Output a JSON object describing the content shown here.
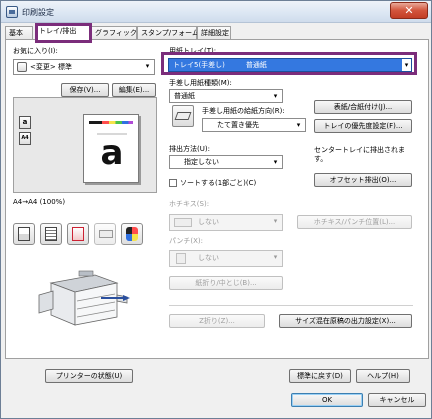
{
  "window": {
    "title": "印刷設定",
    "close_label": "✕"
  },
  "tabs": [
    {
      "label": "基本"
    },
    {
      "label": "トレイ/排出"
    },
    {
      "label": "グラフィックス"
    },
    {
      "label": "スタンプ/フォーム"
    },
    {
      "label": "詳細設定"
    }
  ],
  "favorites": {
    "label": "お気に入り(I):",
    "value": "<変更> 標準",
    "save_label": "保存(V)...",
    "edit_label": "編集(E)..."
  },
  "paper_tray": {
    "label": "用紙トレイ(T):",
    "value": "トレイ5(手差し)　　　普通紙"
  },
  "manual_paper_type": {
    "label": "手差し用紙種類(M):",
    "value": "普通紙"
  },
  "manual_orientation": {
    "label": "手差し用紙の給紙方向(R):",
    "value": "たて置き優先"
  },
  "buttons_right": {
    "cover_insert": "表紙/合紙付け(J)...",
    "tray_priority": "トレイの優先度設定(F)..."
  },
  "output": {
    "label": "排出方法(U):",
    "value": "指定しない",
    "sort_label": "ソートする(1部ごと)(C)",
    "note": "センタートレイに排出されます。",
    "offset_label": "オフセット排出(O)..."
  },
  "staple": {
    "label": "ホチキス(S):",
    "value": "しない",
    "button": "ホチキス/パンチ位置(L)..."
  },
  "punch": {
    "label": "パンチ(X):",
    "value": "しない"
  },
  "fold_button": "紙折り/中とじ(B)...",
  "z_fold_button": "Z折り(Z)...",
  "mixed_size_button": "サイズ混在原稿の出力設定(X)...",
  "preview": {
    "caption": "A4→A4 (100%)",
    "paper_letter": "a",
    "side_icons": [
      {
        "label": "a"
      },
      {
        "label": "A4"
      }
    ]
  },
  "printer_status_button": "プリンターの状態(U)",
  "restore_button": "標準に戻す(D)",
  "help_button": "ヘルプ(H)",
  "ok_button": "OK",
  "cancel_button": "キャンセル"
}
